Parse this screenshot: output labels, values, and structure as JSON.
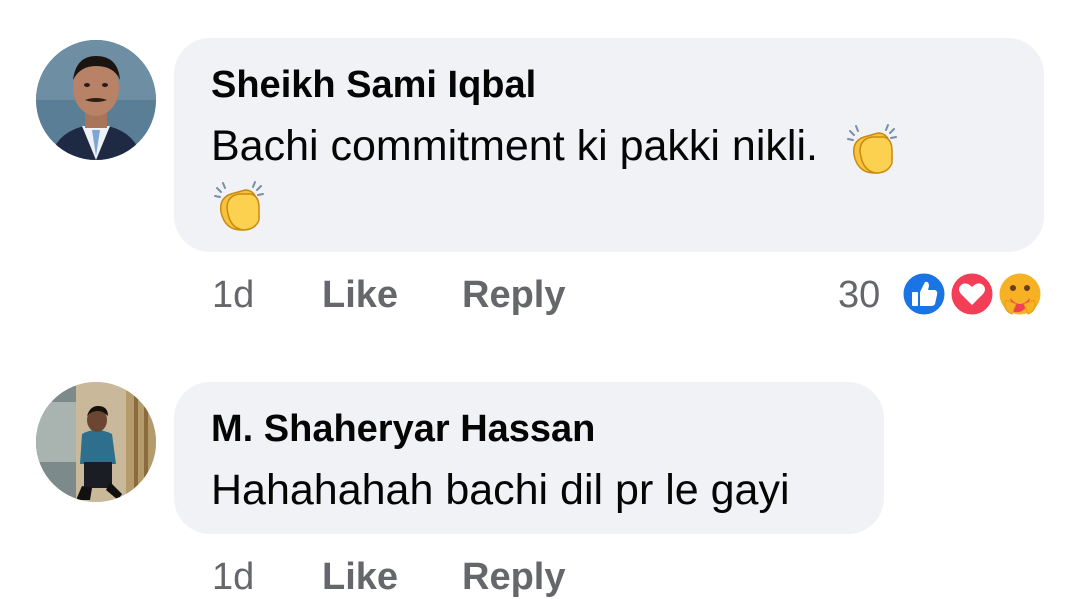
{
  "comments": [
    {
      "author": "Sheikh Sami Iqbal",
      "text": "Bachi commitment ki pakki nikli.",
      "emoji": "clapping-hands",
      "time": "1d",
      "like_label": "Like",
      "reply_label": "Reply",
      "reaction_count": "30",
      "reactions": [
        "like-icon",
        "love-icon",
        "care-icon"
      ]
    },
    {
      "author": "M. Shaheryar Hassan",
      "text": "Hahahahah bachi dil pr le gayi",
      "time": "1d",
      "like_label": "Like",
      "reply_label": "Reply"
    }
  ],
  "colors": {
    "bubble": "#f0f2f5",
    "secondary_text": "#65676b",
    "like_blue": "#1b74e4",
    "love_red": "#f33e58",
    "care_yellow": "#f7b125"
  }
}
